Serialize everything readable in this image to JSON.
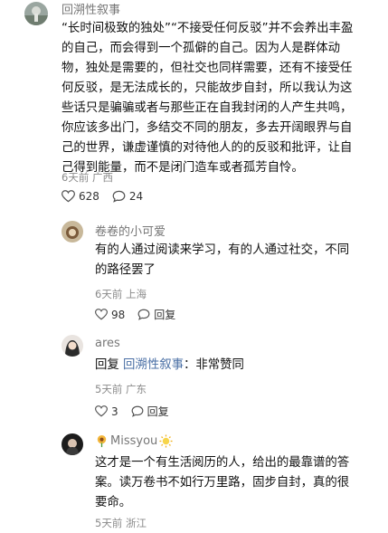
{
  "main_comment": {
    "username": "回溯性叙事",
    "lines": [
      "“长时间极致的独处”“不接受任何反驳”并不会养出丰盈",
      "的自己，而会得到一个孤僻的自己。因为人是群体动",
      "物，独处是需要的，但社交也同样需要，还有不接受任",
      "何反驳，是无法成长的，只能故步自封，所以我认为这",
      "些话只是骗骗或者与那些正在自我封闭的人产生共鸣，",
      "你应该多出门，多结交不同的朋友，多去开阔眼界与自",
      "己的世界，谦虚谨慎的对待他人的的反驳和批评，让自",
      "己得到能量，而不是闭门造车或者孤芳自怜。"
    ],
    "meta": "6天前 广西",
    "likes": "628",
    "replies": "24"
  },
  "replies": [
    {
      "username": "卷卷的小可爱",
      "lines": [
        "有的人通过阅读来学习，有的人通过社交，不同",
        "的路径罢了"
      ],
      "meta": "6天前 上海",
      "likes": "98",
      "reply_label": "回复"
    },
    {
      "username": "ares",
      "reply_prefix": "回复 ",
      "reply_target": "回溯性叙事",
      "reply_text": "：非常赞同",
      "meta": "5天前 广东",
      "likes": "3",
      "reply_label": "回复"
    },
    {
      "username": "Missyou",
      "lines": [
        "这才是一个有生活阅历的人，给出的最靠谱的答",
        "案。读万卷书不如行万里路，固步自封，真的很",
        "要命。"
      ],
      "meta": "5天前 浙江"
    }
  ],
  "colors": {
    "reply_link": "#4a6fa5",
    "meta": "#8a8a8a"
  }
}
